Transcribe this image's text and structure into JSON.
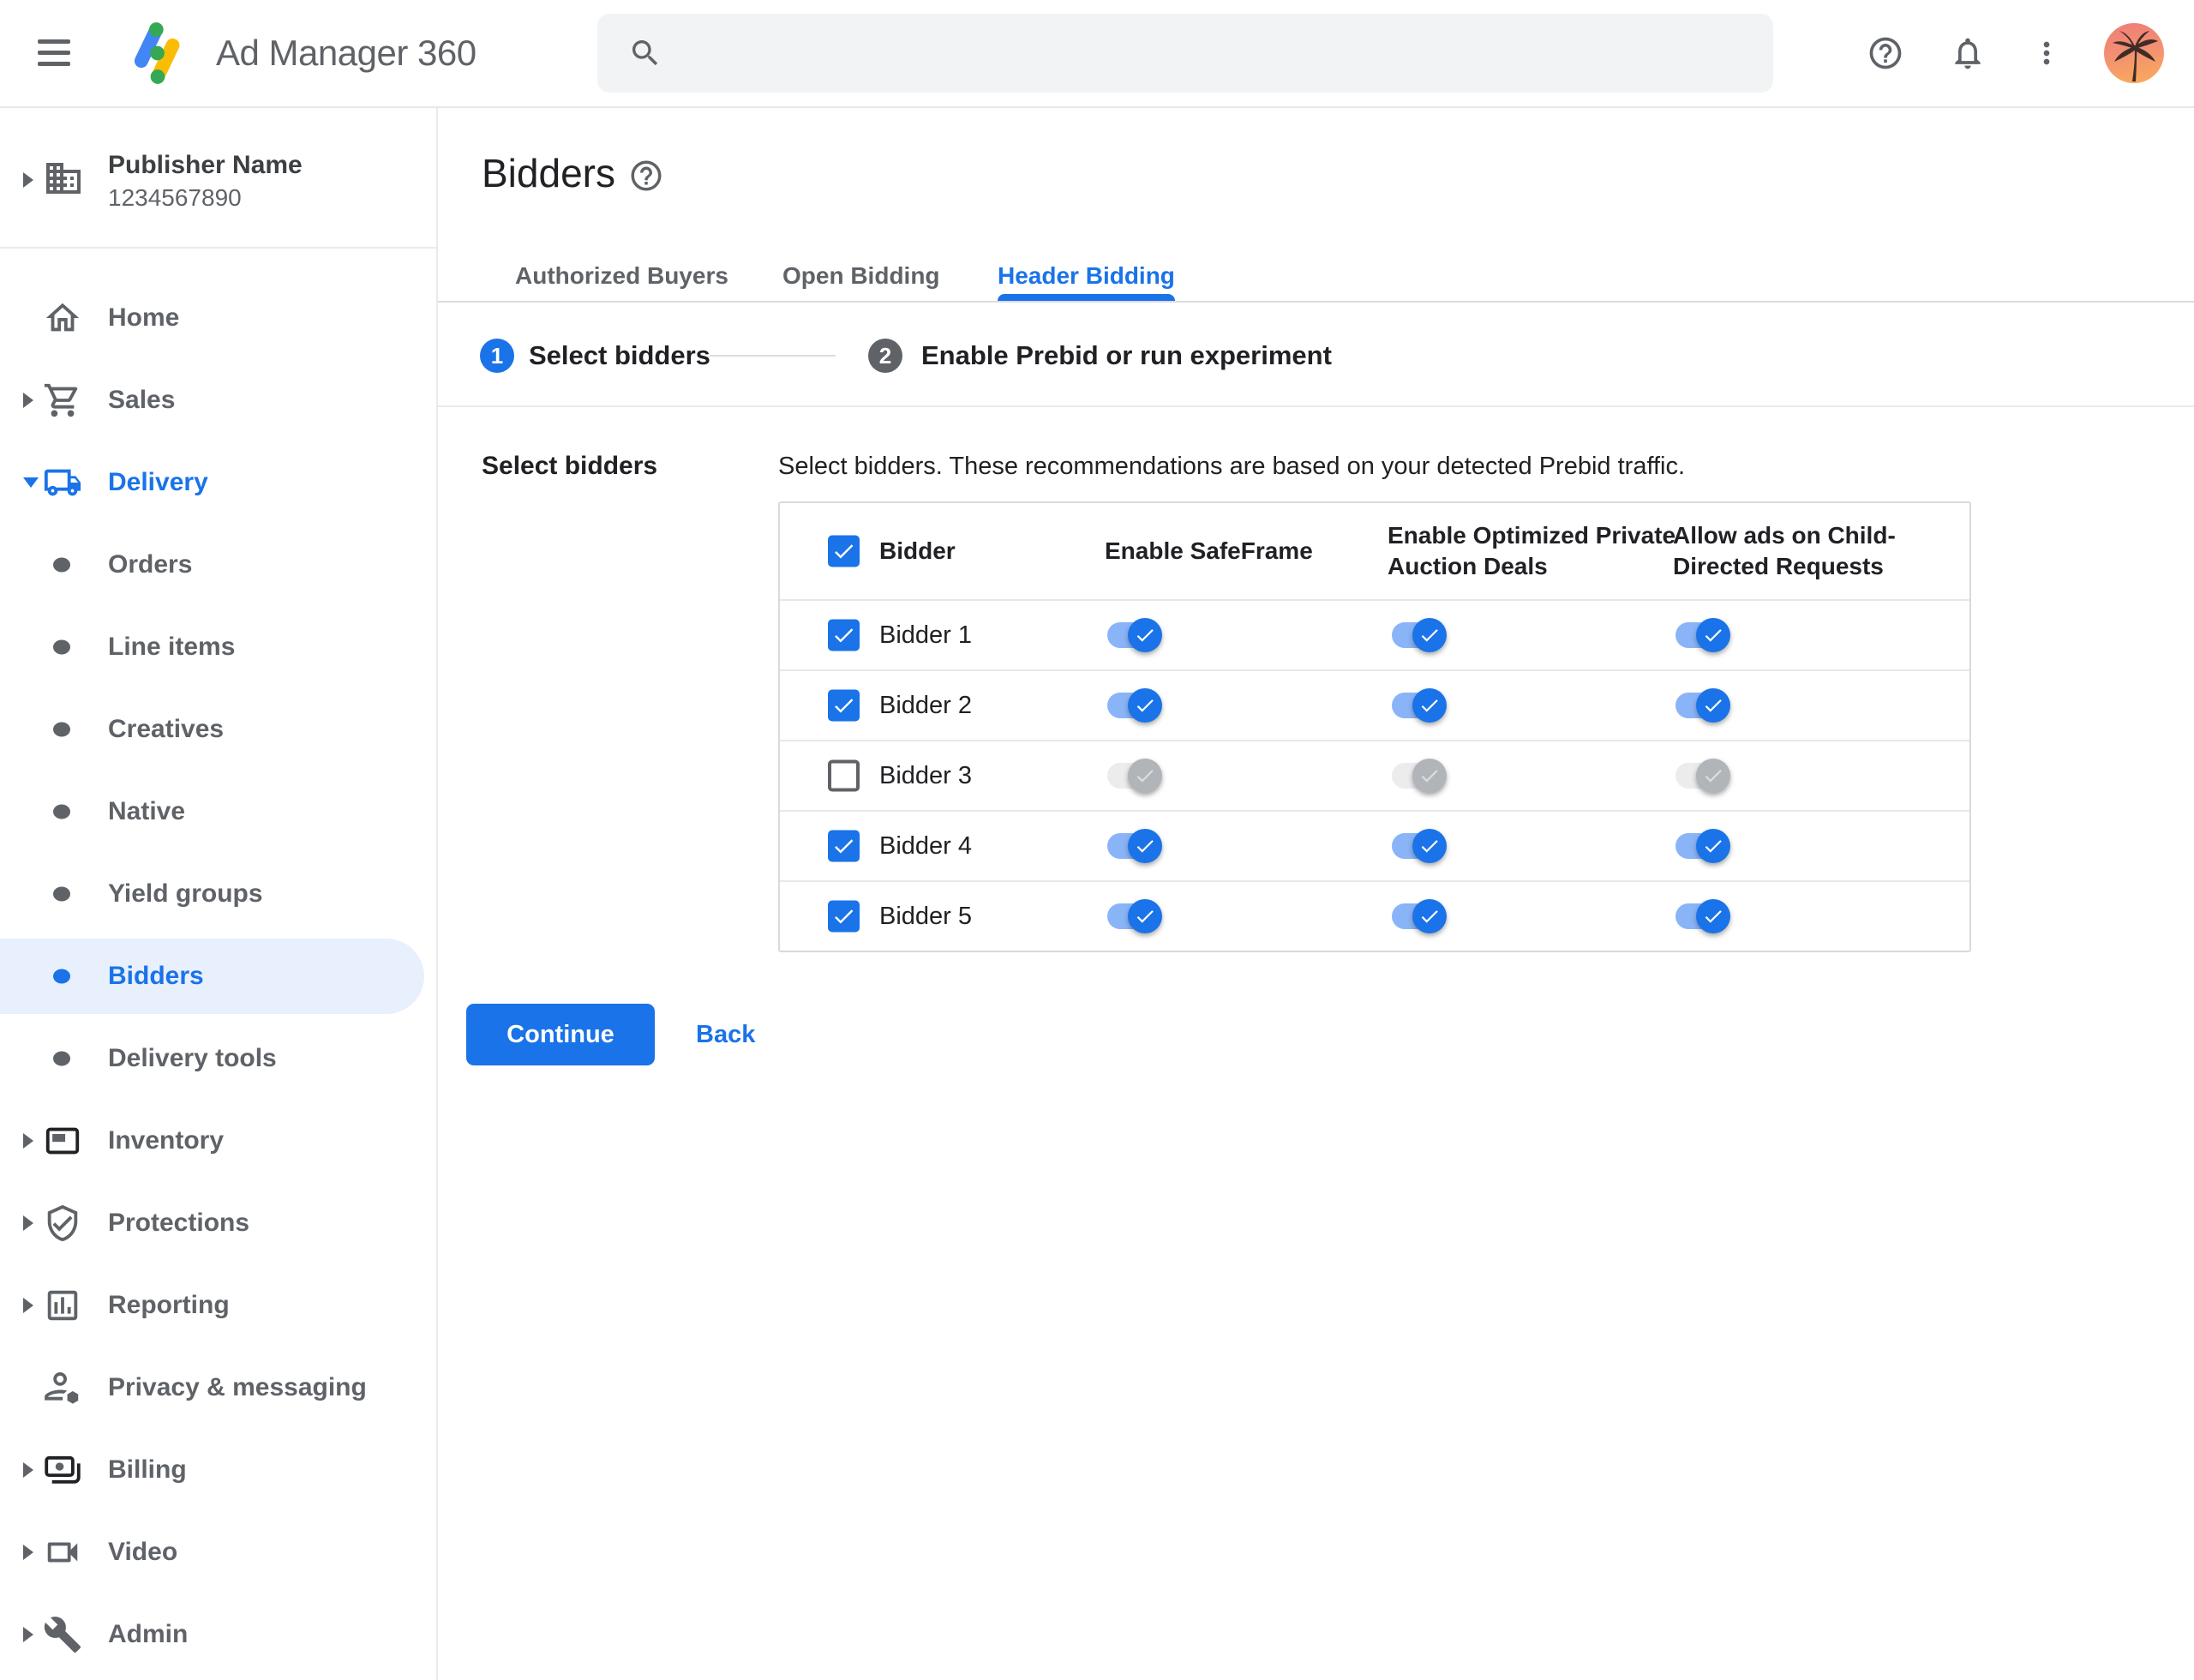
{
  "topbar": {
    "app_name": "Ad Manager 360",
    "search_placeholder": ""
  },
  "sidebar": {
    "publisher": {
      "name": "Publisher Name",
      "id": "1234567890"
    },
    "items": [
      {
        "label": "Home",
        "type": "top",
        "icon": "home-icon",
        "caret": "none"
      },
      {
        "label": "Sales",
        "type": "top",
        "icon": "cart-icon",
        "caret": "right"
      },
      {
        "label": "Delivery",
        "type": "top",
        "icon": "truck-icon",
        "caret": "down",
        "expanded": true,
        "highlight_blue": true
      },
      {
        "label": "Orders",
        "type": "sub"
      },
      {
        "label": "Line items",
        "type": "sub"
      },
      {
        "label": "Creatives",
        "type": "sub"
      },
      {
        "label": "Native",
        "type": "sub"
      },
      {
        "label": "Yield groups",
        "type": "sub"
      },
      {
        "label": "Bidders",
        "type": "sub",
        "active": true
      },
      {
        "label": "Delivery tools",
        "type": "sub"
      },
      {
        "label": "Inventory",
        "type": "top",
        "icon": "inventory-icon",
        "caret": "right"
      },
      {
        "label": "Protections",
        "type": "top",
        "icon": "shield-icon",
        "caret": "right"
      },
      {
        "label": "Reporting",
        "type": "top",
        "icon": "report-icon",
        "caret": "right"
      },
      {
        "label": "Privacy & messaging",
        "type": "top",
        "icon": "privacy-icon",
        "caret": "none"
      },
      {
        "label": "Billing",
        "type": "top",
        "icon": "billing-icon",
        "caret": "right"
      },
      {
        "label": "Video",
        "type": "top",
        "icon": "video-icon",
        "caret": "right"
      },
      {
        "label": "Admin",
        "type": "top",
        "icon": "admin-icon",
        "caret": "right"
      }
    ]
  },
  "main": {
    "title": "Bidders",
    "tabs": [
      {
        "label": "Authorized Buyers",
        "active": false
      },
      {
        "label": "Open Bidding",
        "active": false
      },
      {
        "label": "Header Bidding",
        "active": true
      }
    ],
    "stepper": [
      {
        "number": "1",
        "label": "Select bidders",
        "state": "active"
      },
      {
        "number": "2",
        "label": "Enable Prebid or run experiment",
        "state": "inactive"
      }
    ],
    "section_label": "Select bidders",
    "description": "Select bidders. These recommendations are based on your detected Prebid traffic.",
    "table": {
      "header_checkbox_checked": true,
      "columns": [
        "Bidder",
        "Enable SafeFrame",
        "Enable Optimized Private Auction Deals",
        "Allow ads on Child-Directed Requests"
      ],
      "rows": [
        {
          "name": "Bidder 1",
          "checked": true,
          "enable_safeframe": true,
          "enable_optimized_private_auction_deals": true,
          "allow_ads_child_directed": true
        },
        {
          "name": "Bidder 2",
          "checked": true,
          "enable_safeframe": true,
          "enable_optimized_private_auction_deals": true,
          "allow_ads_child_directed": true
        },
        {
          "name": "Bidder 3",
          "checked": false,
          "enable_safeframe": false,
          "enable_optimized_private_auction_deals": false,
          "allow_ads_child_directed": false
        },
        {
          "name": "Bidder 4",
          "checked": true,
          "enable_safeframe": true,
          "enable_optimized_private_auction_deals": true,
          "allow_ads_child_directed": true
        },
        {
          "name": "Bidder 5",
          "checked": true,
          "enable_safeframe": true,
          "enable_optimized_private_auction_deals": true,
          "allow_ads_child_directed": true
        }
      ]
    },
    "actions": {
      "continue_label": "Continue",
      "back_label": "Back"
    }
  },
  "colors": {
    "accent": "#1a73e8",
    "toggle_track_on": "#8ab4f8",
    "toggle_thumb_on": "#1a73e8",
    "toggle_track_off": "#ececec",
    "toggle_thumb_off": "#b1b4b8",
    "active_item_bg": "#e8f0fe",
    "text_dark": "#202124",
    "text_gray": "#5f6368",
    "border": "#dadce0",
    "search_bg": "#f1f3f4",
    "logo_blue": "#4285f4",
    "logo_yellow": "#fbbc04",
    "logo_green": "#34a853"
  }
}
